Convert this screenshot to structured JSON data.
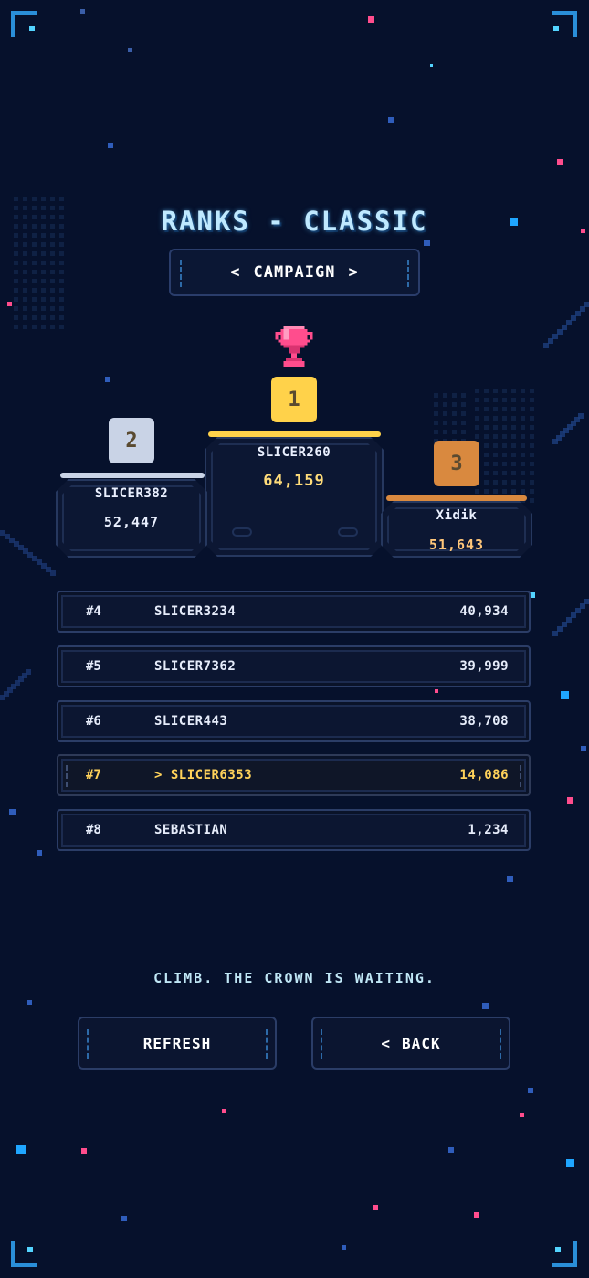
{
  "screen": {
    "title": "RANKS - CLASSIC",
    "mode_selector": {
      "prev_icon": "chevron-left-icon",
      "label": "CAMPAIGN",
      "next_icon": "chevron-right-icon"
    }
  },
  "podium": [
    {
      "place": "1",
      "name": "SLICER260",
      "score": "64,159",
      "color": "#ffd24a",
      "score_color": "#ffdc7a"
    },
    {
      "place": "2",
      "name": "SLICER382",
      "score": "52,447",
      "color": "#c9d3e6",
      "score_color": "#eaf0ff"
    },
    {
      "place": "3",
      "name": "Xidik",
      "score": "51,643",
      "color": "#d9893f",
      "score_color": "#ffc77a"
    }
  ],
  "trophy_icon": "trophy-icon",
  "leaderboard": [
    {
      "rank": "#4",
      "name": "SLICER3234",
      "score": "40,934"
    },
    {
      "rank": "#5",
      "name": "SLICER7362",
      "score": "39,999"
    },
    {
      "rank": "#6",
      "name": "SLICER443",
      "score": "38,708"
    },
    {
      "rank": "#7",
      "name": "> SLICER6353",
      "score": "14,086",
      "is_current_player": true
    },
    {
      "rank": "#8",
      "name": "SEBASTIAN",
      "score": "1,234"
    }
  ],
  "tagline": "CLIMB. THE CROWN IS WAITING.",
  "buttons": {
    "refresh": "REFRESH",
    "back": "BACK",
    "back_icon": "chevron-left-icon"
  },
  "colors": {
    "background": "#06112c",
    "accent": "#53d4ff",
    "gold": "#ffd25a",
    "trophy": "#ff4d8d"
  }
}
